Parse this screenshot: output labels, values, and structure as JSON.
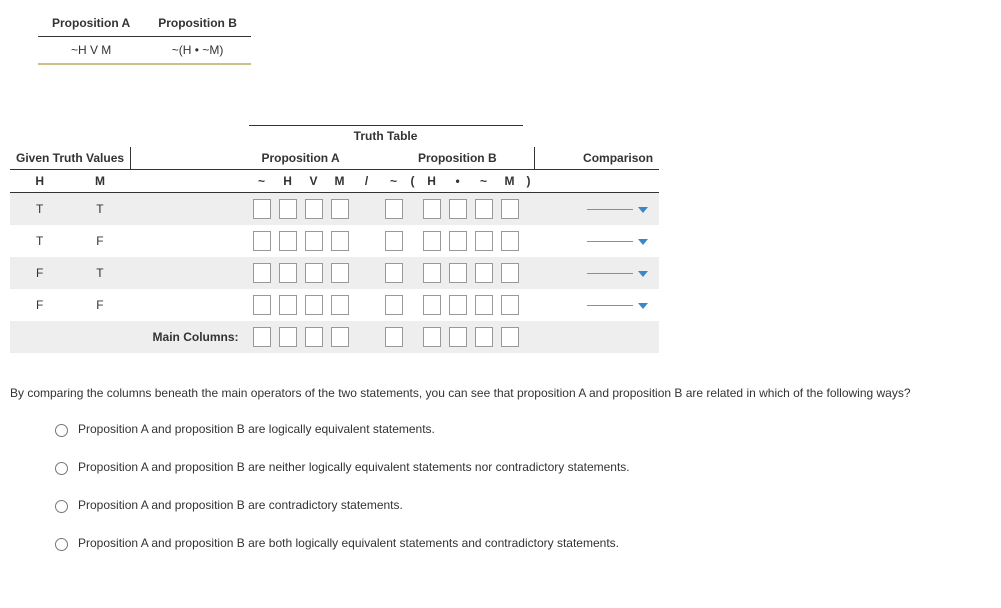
{
  "propositions": {
    "headerA": "Proposition A",
    "headerB": "Proposition B",
    "valueA": "~H V M",
    "valueB": "~(H • ~M)"
  },
  "truthTable": {
    "title": "Truth Table",
    "givenHeader": "Given Truth Values",
    "propAHeader": "Proposition A",
    "propBHeader": "Proposition B",
    "comparisonHeader": "Comparison",
    "givenCols": [
      "H",
      "M"
    ],
    "propASymbols": [
      "~",
      "H",
      "V",
      "M"
    ],
    "divider": "/",
    "propBSymbols": [
      "~",
      "(",
      "H",
      "•",
      "~",
      "M",
      ")"
    ],
    "rows": [
      {
        "H": "T",
        "M": "T"
      },
      {
        "H": "T",
        "M": "F"
      },
      {
        "H": "F",
        "M": "T"
      },
      {
        "H": "F",
        "M": "F"
      }
    ],
    "mainColumnsLabel": "Main Columns:"
  },
  "questionText": "By comparing the columns beneath the main operators of the two statements, you can see that proposition A and proposition B are related in which of the following ways?",
  "options": [
    "Proposition A and proposition B are logically equivalent statements.",
    "Proposition A and proposition B are neither logically equivalent statements nor contradictory statements.",
    "Proposition A and proposition B are contradictory statements.",
    "Proposition A and proposition B are both logically equivalent statements and contradictory statements."
  ]
}
